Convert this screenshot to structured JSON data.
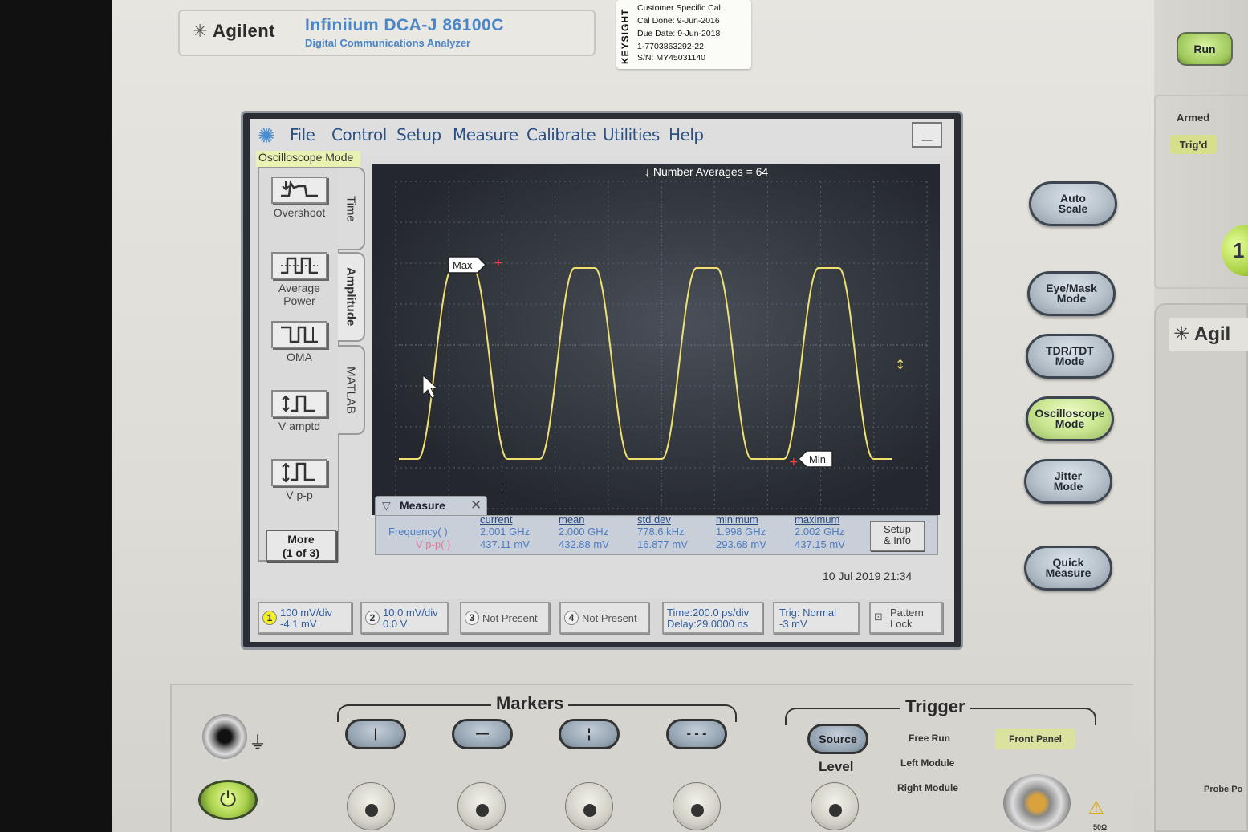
{
  "brand": {
    "logo": "Agilent",
    "model": "Infiniium  DCA-J  86100C",
    "subtitle": "Digital Communications Analyzer"
  },
  "cal_card": {
    "vendor": "KEYSIGHT",
    "line1": "Customer Specific Cal",
    "line2": "Cal Done:  9-Jun-2016",
    "line3": "Due Date:  9-Jun-2018",
    "line4": "1-7703863292-22",
    "line5": "S/N: MY45031140"
  },
  "menu": {
    "items": [
      "File",
      "Control",
      "Setup",
      "Measure",
      "Calibrate",
      "Utilities",
      "Help"
    ],
    "minimize": "_"
  },
  "mode_label": "Oscilloscope Mode",
  "measure_buttons": [
    {
      "label": "Overshoot"
    },
    {
      "label": "Average Power"
    },
    {
      "label": "OMA"
    },
    {
      "label": "V amptd"
    },
    {
      "label": "V p-p"
    }
  ],
  "more_button": {
    "line1": "More",
    "line2": "(1 of 3)"
  },
  "tabs": [
    "Time",
    "Amplitude",
    "MATLAB"
  ],
  "plot": {
    "avg_label": "Number Averages =  64",
    "max_marker": "Max",
    "min_marker": "Min"
  },
  "measure_panel": {
    "title": "Measure",
    "headers": [
      "current",
      "mean",
      "std dev",
      "minimum",
      "maximum"
    ],
    "rows": [
      {
        "label": "Frequency(  )",
        "values": [
          "2.001 GHz",
          "2.000 GHz",
          "778.6 kHz",
          "1.998 GHz",
          "2.002 GHz"
        ]
      },
      {
        "label": "V p-p(  )",
        "values": [
          "437.11 mV",
          "432.88 mV",
          "16.877 mV",
          "293.68 mV",
          "437.15 mV"
        ]
      }
    ],
    "setup_line1": "Setup",
    "setup_line2": "& Info"
  },
  "datetime": "10 Jul 2019   21:34",
  "status": {
    "ch1": {
      "num": "1",
      "line1": "100 mV/div",
      "line2": "-4.1 mV"
    },
    "ch2": {
      "num": "2",
      "line1": "10.0 mV/div",
      "line2": "0.0 V"
    },
    "ch3": {
      "num": "3",
      "line1": "Not Present"
    },
    "ch4": {
      "num": "4",
      "line1": "Not Present"
    },
    "time": {
      "line1": "Time:200.0 ps/div",
      "line2": "Delay:29.0000 ns"
    },
    "trig": {
      "line1": "Trig: Normal",
      "line2": "-3 mV"
    },
    "pattern": {
      "line1": "Pattern",
      "line2": "Lock"
    }
  },
  "side_buttons": {
    "auto_scale": [
      "Auto",
      "Scale"
    ],
    "eye_mask": [
      "Eye/Mask",
      "Mode"
    ],
    "tdr": [
      "TDR/TDT",
      "Mode"
    ],
    "osc": [
      "Oscilloscope",
      "Mode"
    ],
    "jitter": [
      "Jitter",
      "Mode"
    ],
    "quick": [
      "Quick",
      "Measure"
    ]
  },
  "right_panel": {
    "run": "Run",
    "armed": "Armed",
    "trigd": "Trig'd",
    "knob_label": "1",
    "module_brand": "Agil"
  },
  "lower": {
    "markers_title": "Markers",
    "marker_buttons": [
      "|",
      "—",
      "¦",
      "- - -"
    ],
    "trigger_title": "Trigger",
    "source": "Source",
    "level": "Level",
    "free_run": "Free Run",
    "left_module": "Left Module",
    "right_module": "Right Module",
    "front_panel": "Front Panel",
    "probe": "Probe Po",
    "ohm": "50Ω"
  },
  "colors": {
    "trace": "#f0e070",
    "menu_text": "#2a4f80",
    "value_text": "#4a7cc4",
    "mode_highlight": "#e9f2b0"
  }
}
